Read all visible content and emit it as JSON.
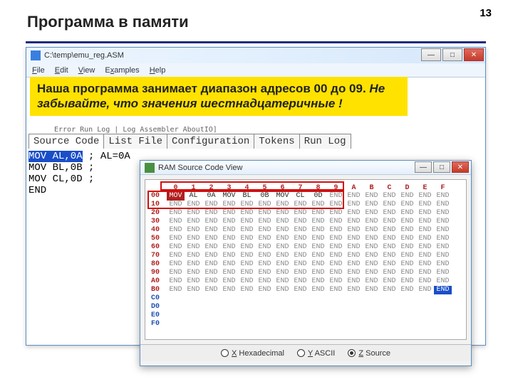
{
  "slide": {
    "title": "Программа в памяти",
    "page": "13"
  },
  "callout": {
    "line1": "Наша программа занимает диапазон адресов 00 до 09. ",
    "line2": "Не забывайте, что значения шестнадцатеричные !"
  },
  "main_window": {
    "title": "C:\\temp\\emu_reg.ASM",
    "menu": {
      "file": "File",
      "edit": "Edit",
      "view": "View",
      "examples": "Examples",
      "help": "Help"
    },
    "shadow_text": "  Error Run Log   |   Log Assembler AboutIO]",
    "tabs": {
      "source": "Source Code",
      "list": "List File",
      "config": "Configuration",
      "tokens": "Tokens",
      "runlog": "Run Log"
    },
    "editor": {
      "l1a": "MOV AL,0A",
      "l1b": " ; AL=0A",
      "l2": "MOV BL,0B ;",
      "l3": "MOV CL,0D ;",
      "l4": "END"
    }
  },
  "ram_window": {
    "title": "RAM Source Code View",
    "cols": [
      "0",
      "1",
      "2",
      "3",
      "4",
      "5",
      "6",
      "7",
      "8",
      "9",
      "A",
      "B",
      "C",
      "D",
      "E",
      "F"
    ],
    "row00": [
      "MOV",
      "AL",
      "0A",
      "MOV",
      "BL",
      "0B",
      "MOV",
      "CL",
      "0D",
      "END",
      "END",
      "END",
      "END",
      "END",
      "END",
      "END"
    ],
    "addr_labels": [
      "00",
      "10",
      "20",
      "30",
      "40",
      "50",
      "60",
      "70",
      "80",
      "90",
      "A0",
      "B0",
      "C0",
      "D0",
      "E0",
      "F0"
    ],
    "end_token": "END",
    "footer": {
      "hex": "X Hexadecimal",
      "ascii": "Y ASCII",
      "source": "Z Source"
    }
  }
}
